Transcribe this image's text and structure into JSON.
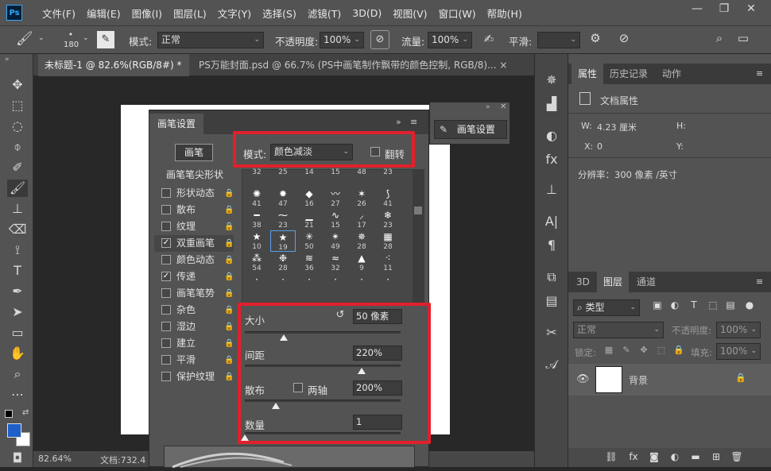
{
  "app": {
    "logo": "Ps"
  },
  "menu": [
    "文件(F)",
    "编辑(E)",
    "图像(I)",
    "图层(L)",
    "文字(Y)",
    "选择(S)",
    "滤镜(T)",
    "3D(D)",
    "视图(V)",
    "窗口(W)",
    "帮助(H)"
  ],
  "window": {
    "minimize": "—",
    "maximize": "❐",
    "close": "✕"
  },
  "options": {
    "brush_size": "180",
    "mode_label": "模式:",
    "mode_value": "正常",
    "opacity_label": "不透明度:",
    "opacity_value": "100%",
    "flow_label": "流量:",
    "flow_value": "100%",
    "smooth_label": "平滑:"
  },
  "tabs": [
    {
      "label": "未标题-1 @ 82.6%(RGB/8#) *",
      "close": "×"
    },
    {
      "label": "PS万能封面.psd @ 66.7% (PS中画笔制作飘带的颜色控制, RGB/8)...",
      "close": "×"
    }
  ],
  "status": {
    "zoom": "82.64%",
    "doc": "文档:732.4"
  },
  "brush_settings": {
    "title": "画笔设置",
    "brush_button": "画笔",
    "mode_label": "模式:",
    "mode_value": "颜色减淡",
    "flip_label": "翻转",
    "section_title": "画笔笔尖形状",
    "properties": [
      {
        "name": "形状动态",
        "checked": false
      },
      {
        "name": "散布",
        "checked": false
      },
      {
        "name": "纹理",
        "checked": false
      },
      {
        "name": "双重画笔",
        "checked": true
      },
      {
        "name": "颜色动态",
        "checked": false
      },
      {
        "name": "传递",
        "checked": true
      },
      {
        "name": "画笔笔势",
        "checked": false
      },
      {
        "name": "杂色",
        "checked": false
      },
      {
        "name": "湿边",
        "checked": false
      },
      {
        "name": "建立",
        "checked": false
      },
      {
        "name": "平滑",
        "checked": false
      },
      {
        "name": "保护纹理",
        "checked": false
      }
    ],
    "brushes": [
      {
        "g": "",
        "s": "32"
      },
      {
        "g": "",
        "s": "25"
      },
      {
        "g": "",
        "s": "14"
      },
      {
        "g": "",
        "s": "15"
      },
      {
        "g": "",
        "s": "48"
      },
      {
        "g": "",
        "s": "23"
      },
      {
        "g": "✺",
        "s": "41"
      },
      {
        "g": "✹",
        "s": "47"
      },
      {
        "g": "◆",
        "s": "16"
      },
      {
        "g": "〰",
        "s": "27"
      },
      {
        "g": "✶",
        "s": "26"
      },
      {
        "g": "⟆",
        "s": "41"
      },
      {
        "g": "━",
        "s": "38"
      },
      {
        "g": "⁓",
        "s": "23"
      },
      {
        "g": "▁",
        "s": "21"
      },
      {
        "g": "∿",
        "s": "15"
      },
      {
        "g": "⸝",
        "s": "17"
      },
      {
        "g": "❄",
        "s": "23"
      },
      {
        "g": "★",
        "s": "10"
      },
      {
        "g": "★",
        "s": "19"
      },
      {
        "g": "✳",
        "s": "50"
      },
      {
        "g": "✴",
        "s": "49"
      },
      {
        "g": "✵",
        "s": "28"
      },
      {
        "g": "▦",
        "s": "28"
      },
      {
        "g": "⁂",
        "s": "54"
      },
      {
        "g": "❉",
        "s": "28"
      },
      {
        "g": "≋",
        "s": "36"
      },
      {
        "g": "≈",
        "s": "32"
      },
      {
        "g": "▲",
        "s": "9"
      },
      {
        "g": "⁖",
        "s": "11"
      },
      {
        "g": "·",
        "s": ""
      },
      {
        "g": "·",
        "s": ""
      },
      {
        "g": "·",
        "s": ""
      },
      {
        "g": "·",
        "s": ""
      },
      {
        "g": "·",
        "s": ""
      },
      {
        "g": "·",
        "s": ""
      }
    ],
    "selected_brush": "19",
    "size_label": "大小",
    "size_value": "50 像素",
    "spacing_label": "间距",
    "spacing_value": "220%",
    "scatter_label": "散布",
    "both_axes_label": "两轴",
    "scatter_value": "200%",
    "count_label": "数量",
    "count_value": "1"
  },
  "slider_levels": {
    "size": 0.25,
    "spacing": 0.75,
    "scatter": 0.2,
    "count": 0.0
  },
  "floating_panel": {
    "label": "画笔设置"
  },
  "properties_panel": {
    "tabs": [
      "属性",
      "历史记录",
      "动作"
    ],
    "doc_props": "文档属性",
    "w_label": "W:",
    "w_value": "4.23 厘米",
    "h_label": "H:",
    "x_label": "X:",
    "x_value": "0",
    "y_label": "Y:",
    "resolution": "分辨率：300 像素 /英寸"
  },
  "layers_panel": {
    "tabs": [
      "3D",
      "图层",
      "通道"
    ],
    "filter_label": "类型",
    "blend": "正常",
    "opacity_label": "不透明度:",
    "opacity_value": "100%",
    "lock_label": "锁定:",
    "fill_label": "填充:",
    "fill_value": "100%",
    "layer_name": "背景"
  },
  "colors": {
    "foreground": "#1f5fc8",
    "background": "#ffffff",
    "highlight": "#e0202b"
  }
}
